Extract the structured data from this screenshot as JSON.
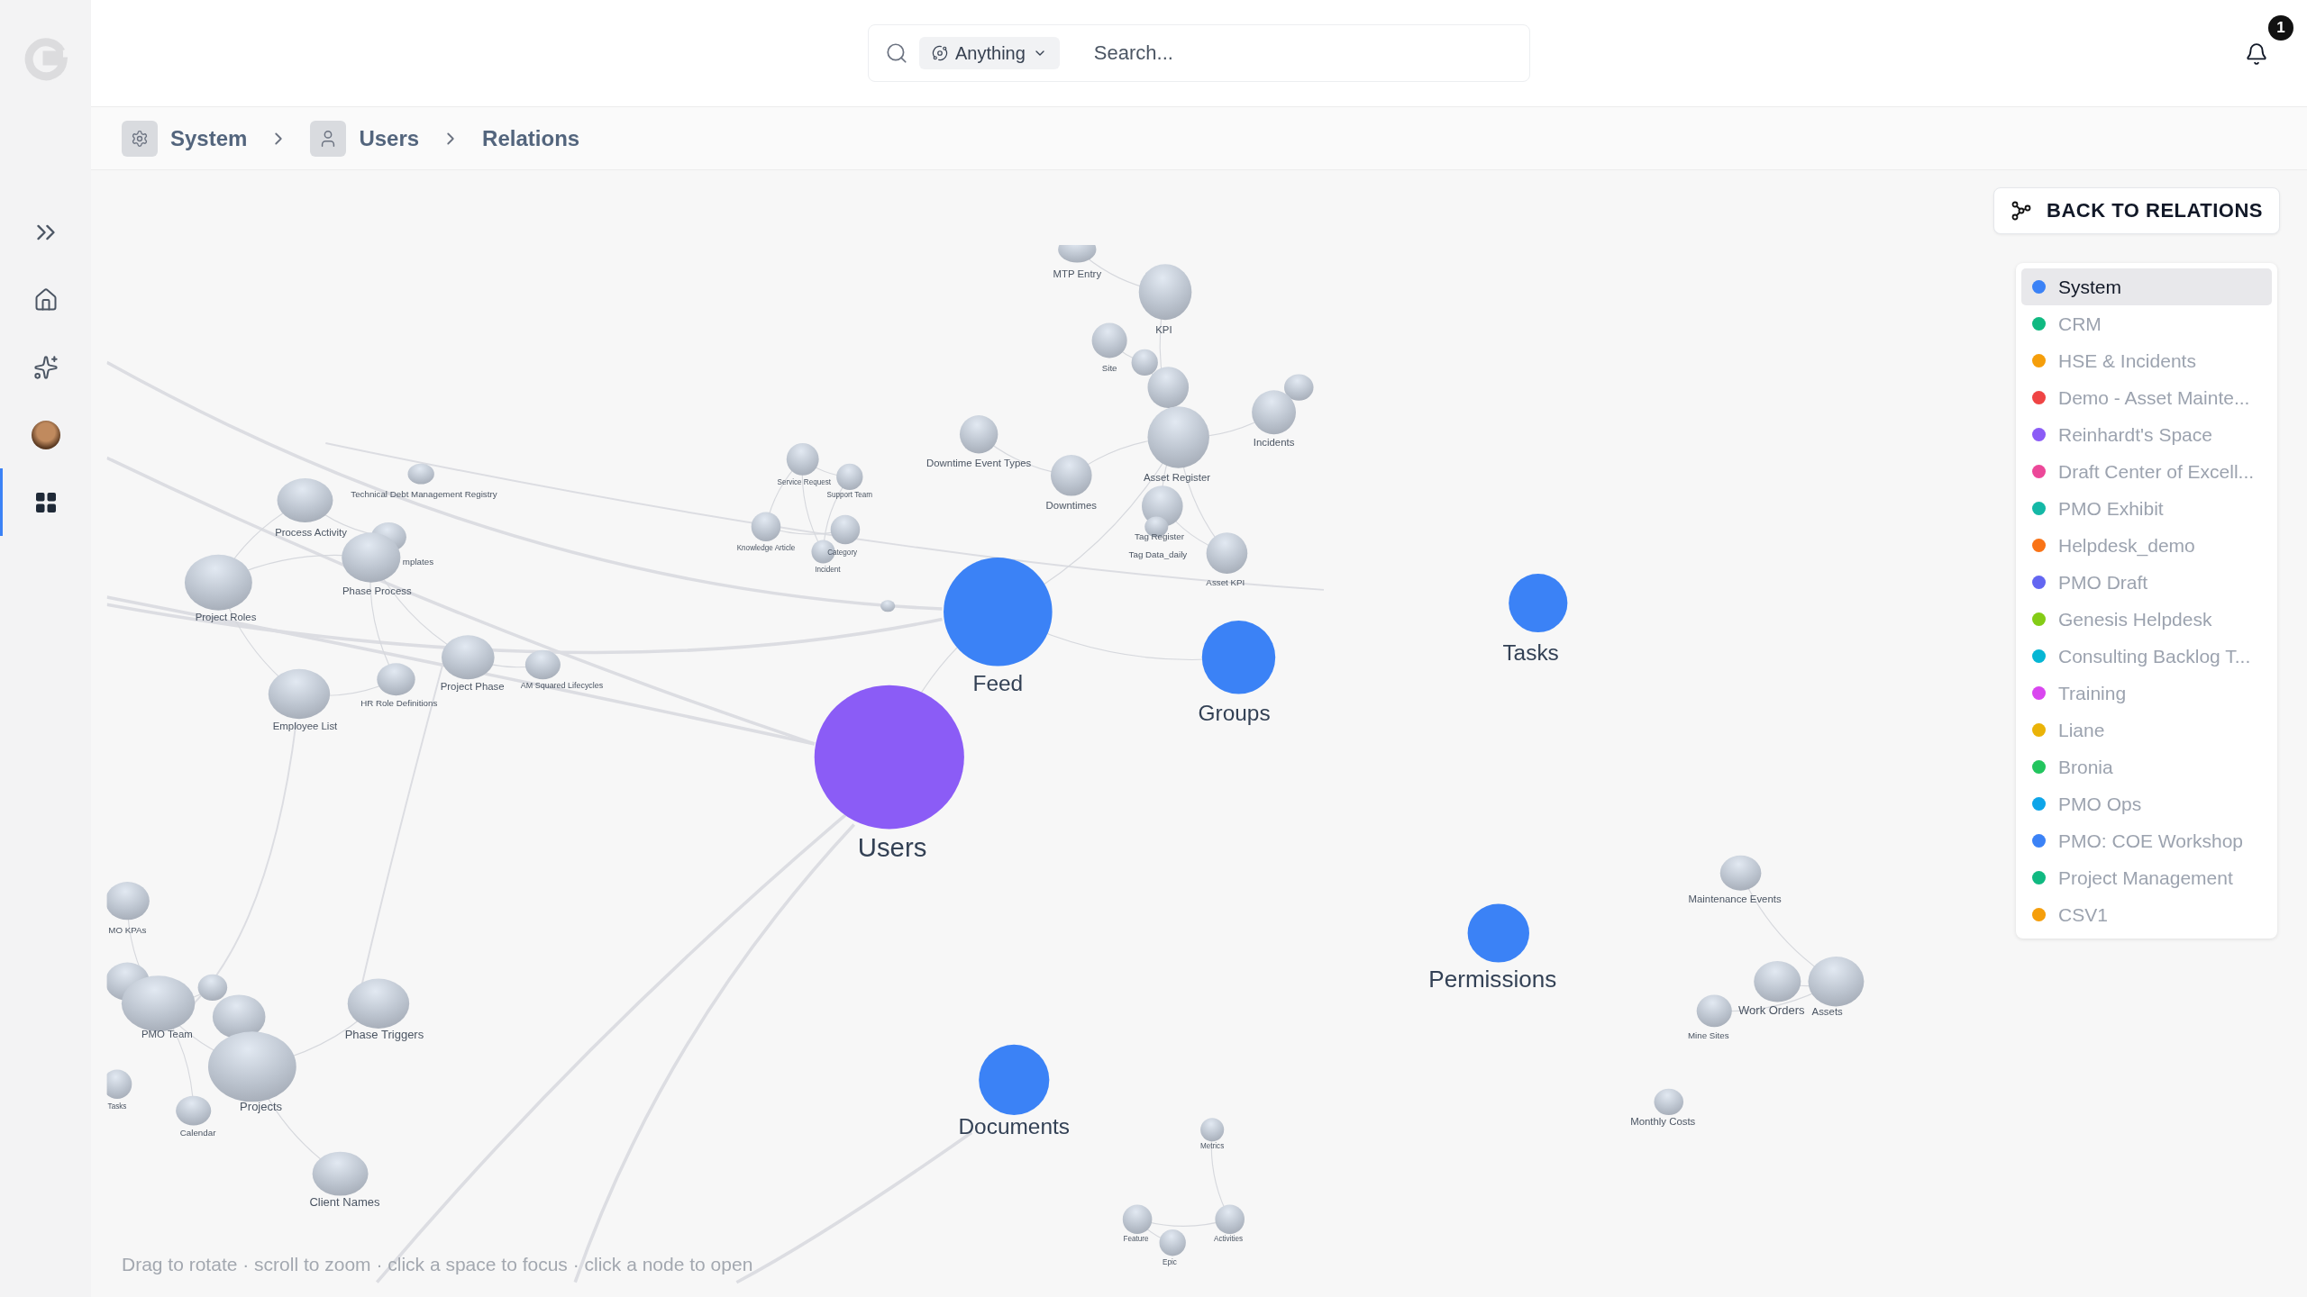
{
  "header": {
    "search": {
      "scope": "Anything",
      "placeholder": "Search..."
    },
    "notifications": {
      "count": "1"
    }
  },
  "sidebar": {
    "items": [
      {
        "kind": "expand",
        "selected": false
      },
      {
        "kind": "home",
        "selected": false
      },
      {
        "kind": "ai",
        "selected": false
      },
      {
        "kind": "avatar",
        "selected": false
      },
      {
        "kind": "apps",
        "selected": true
      }
    ]
  },
  "breadcrumbs": [
    {
      "label": "System"
    },
    {
      "label": "Users"
    },
    {
      "label": "Relations"
    }
  ],
  "back_button": {
    "label": "BACK TO RELATIONS"
  },
  "legend": [
    {
      "label": "System",
      "color": "#3b82f6",
      "selected": true
    },
    {
      "label": "CRM",
      "color": "#10b981",
      "selected": false
    },
    {
      "label": "HSE & Incidents",
      "color": "#f59e0b",
      "selected": false
    },
    {
      "label": "Demo - Asset Mainte...",
      "color": "#ef4444",
      "selected": false
    },
    {
      "label": "Reinhardt's Space",
      "color": "#8b5cf6",
      "selected": false
    },
    {
      "label": "Draft Center of Excell...",
      "color": "#ec4899",
      "selected": false
    },
    {
      "label": "PMO Exhibit",
      "color": "#14b8a6",
      "selected": false
    },
    {
      "label": "Helpdesk_demo",
      "color": "#f97316",
      "selected": false
    },
    {
      "label": "PMO Draft",
      "color": "#6366f1",
      "selected": false
    },
    {
      "label": "Genesis Helpdesk",
      "color": "#84cc16",
      "selected": false
    },
    {
      "label": "Consulting Backlog T...",
      "color": "#06b6d4",
      "selected": false
    },
    {
      "label": "Training",
      "color": "#d946ef",
      "selected": false
    },
    {
      "label": "Liane",
      "color": "#eab308",
      "selected": false
    },
    {
      "label": "Bronia",
      "color": "#22c55e",
      "selected": false
    },
    {
      "label": "PMO Ops",
      "color": "#0ea5e9",
      "selected": false
    },
    {
      "label": "PMO: COE Workshop",
      "color": "#3b82f6",
      "selected": false
    },
    {
      "label": "Project Management",
      "color": "#10b981",
      "selected": false
    },
    {
      "label": "CSV1",
      "color": "#f59e0b",
      "selected": false
    }
  ],
  "graph": {
    "hint": "Drag to rotate · scroll to zoom · click a space to focus · click a node to open",
    "nodes": [
      {
        "label": "Feed",
        "kind": "space",
        "color": "#3b82f6"
      },
      {
        "label": "Groups",
        "kind": "space",
        "color": "#3b82f6"
      },
      {
        "label": "Tasks",
        "kind": "space",
        "color": "#3b82f6"
      },
      {
        "label": "Users",
        "kind": "space",
        "color": "#8b5cf6"
      },
      {
        "label": "Permissions",
        "kind": "space",
        "color": "#3b82f6"
      },
      {
        "label": "Documents",
        "kind": "space",
        "color": "#3b82f6"
      },
      {
        "label": "MTP Entry",
        "kind": "entity"
      },
      {
        "label": "KPI",
        "kind": "entity"
      },
      {
        "label": "Site",
        "kind": "entity"
      },
      {
        "kind": "entity"
      },
      {
        "kind": "entity"
      },
      {
        "label": "Asset Register",
        "kind": "entity"
      },
      {
        "kind": "entity"
      },
      {
        "label": "Incidents",
        "kind": "entity"
      },
      {
        "label": "Downtime Event Types",
        "kind": "entity"
      },
      {
        "label": "Downtimes",
        "kind": "entity"
      },
      {
        "label": "Tag Register",
        "kind": "entity"
      },
      {
        "label": "Tag Data_daily",
        "kind": "entity"
      },
      {
        "label": "Asset KPI",
        "kind": "entity"
      },
      {
        "label": "Service Request",
        "kind": "entity"
      },
      {
        "label": "Support Team",
        "kind": "entity"
      },
      {
        "label": "Knowledge Article",
        "kind": "entity"
      },
      {
        "label": "Category",
        "kind": "entity"
      },
      {
        "label": "Incident",
        "kind": "entity"
      },
      {
        "kind": "entity"
      },
      {
        "label": "Technical Debt Management Registry",
        "kind": "entity"
      },
      {
        "label": "Process Activity",
        "kind": "entity"
      },
      {
        "label": "mplates",
        "kind": "entity"
      },
      {
        "label": "Phase Process",
        "kind": "entity"
      },
      {
        "label": "Project Roles",
        "kind": "entity"
      },
      {
        "label": "Project Phase",
        "kind": "entity"
      },
      {
        "label": "AM Squared Lifecycles",
        "kind": "entity"
      },
      {
        "label": "HR Role Definitions",
        "kind": "entity"
      },
      {
        "label": "Employee List",
        "kind": "entity"
      },
      {
        "label": "MO KPAs",
        "kind": "entity"
      },
      {
        "kind": "entity"
      },
      {
        "label": "PMO Team",
        "kind": "entity"
      },
      {
        "kind": "entity"
      },
      {
        "kind": "entity"
      },
      {
        "label": "Tasks",
        "kind": "entity"
      },
      {
        "label": "Projects",
        "kind": "entity"
      },
      {
        "label": "Calendar",
        "kind": "entity"
      },
      {
        "label": "Phase Triggers",
        "kind": "entity"
      },
      {
        "label": "Client Names",
        "kind": "entity"
      },
      {
        "label": "Maintenance Events",
        "kind": "entity"
      },
      {
        "label": "Work Orders",
        "kind": "entity"
      },
      {
        "label": "Assets",
        "kind": "entity"
      },
      {
        "label": "Mine Sites",
        "kind": "entity"
      },
      {
        "label": "Monthly Costs",
        "kind": "entity"
      },
      {
        "label": "Metrics",
        "kind": "entity"
      },
      {
        "label": "Feature",
        "kind": "entity"
      },
      {
        "label": "Epic",
        "kind": "entity"
      },
      {
        "label": "Activities",
        "kind": "entity"
      }
    ]
  }
}
